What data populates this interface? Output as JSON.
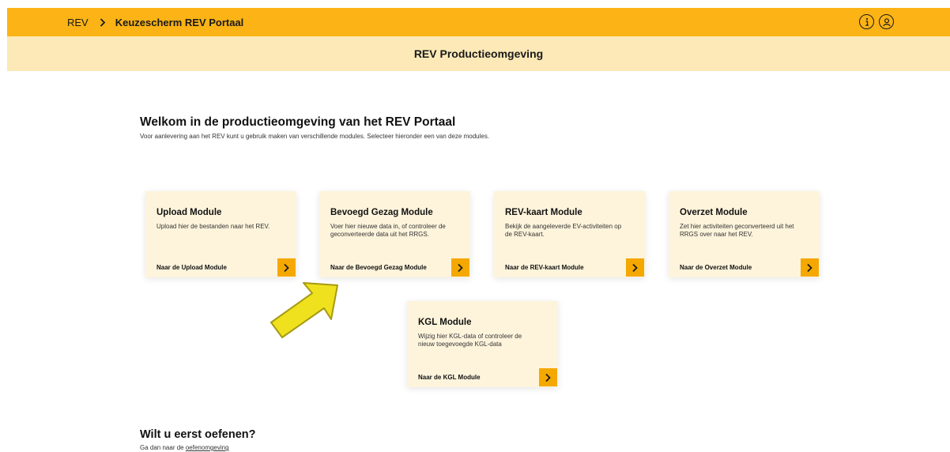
{
  "header": {
    "breadcrumb_root": "REV",
    "breadcrumb_current": "Keuzescherm REV Portaal",
    "icons": [
      "info-icon",
      "user-icon"
    ]
  },
  "environment": {
    "title": "REV Productieomgeving"
  },
  "welcome": {
    "title": "Welkom in de productieomgeving van het REV Portaal",
    "subtitle": "Voor aanlevering aan het REV kunt u gebruik maken van verschillende modules. Selecteer hieronder een van deze modules."
  },
  "modules": [
    {
      "title": "Upload Module",
      "description": "Upload hier de bestanden naar het REV.",
      "link": "Naar de Upload Module"
    },
    {
      "title": "Bevoegd Gezag Module",
      "description": "Voer hier nieuwe data in, of controleer de geconverteerde data uit het RRGS.",
      "link": "Naar de Bevoegd Gezag Module"
    },
    {
      "title": "REV-kaart Module",
      "description": "Bekijk de aangeleverde EV-activiteiten op de REV-kaart.",
      "link": "Naar de REV-kaart Module"
    },
    {
      "title": "Overzet Module",
      "description": "Zet hier activiteiten geconverteerd uit het RRGS over naar het REV.",
      "link": "Naar de Overzet Module"
    },
    {
      "title": "KGL Module",
      "description": "Wijzig hier KGL-data of controleer de nieuw toegevoegde KGL-data",
      "link": "Naar de KGL Module"
    }
  ],
  "practice": {
    "title": "Wilt u eerst oefenen?",
    "prefix": "Ga dan naar de",
    "link": "oefenomgeving"
  },
  "colors": {
    "header": "#fbb315",
    "environment_bar": "#fde9b7",
    "card": "#fef4dc",
    "arrow_button": "#f5a800",
    "annotation_arrow": "#f0e11e"
  }
}
